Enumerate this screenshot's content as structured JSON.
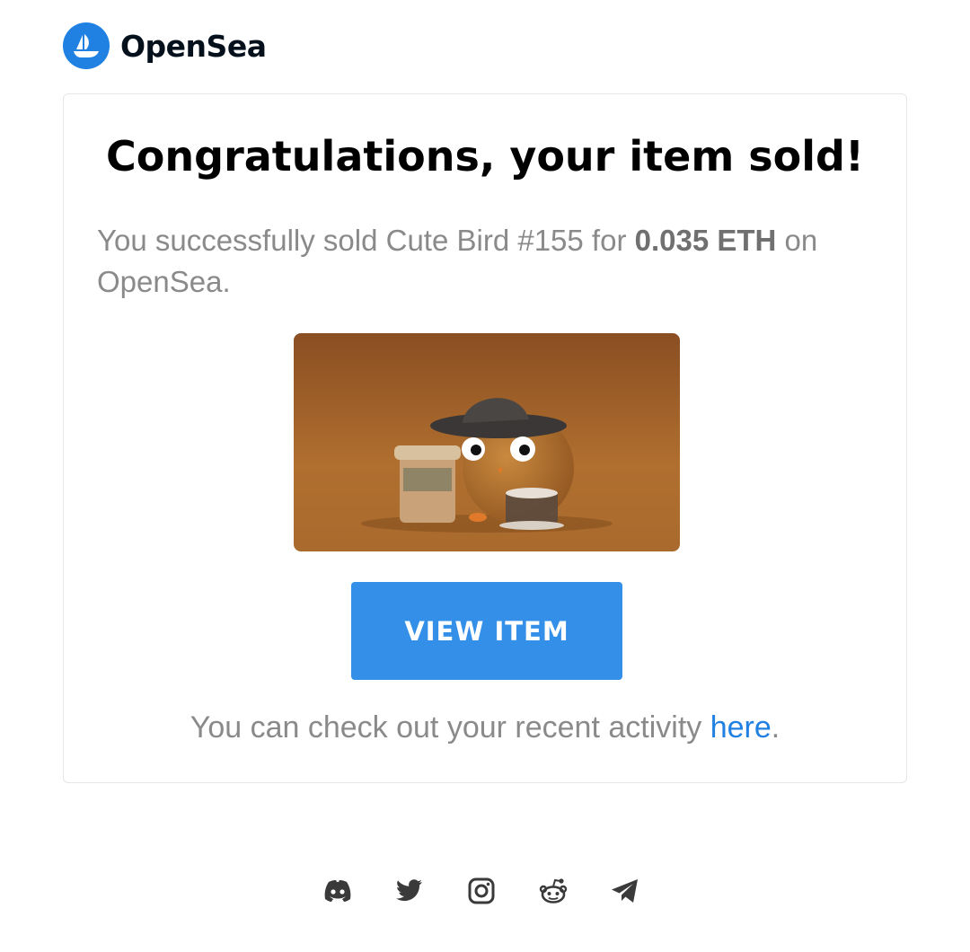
{
  "header": {
    "brand": "OpenSea",
    "logo_icon": "opensea-boat-icon",
    "brand_color": "#2081e2"
  },
  "card": {
    "title": "Congratulations, your item sold!",
    "description_prefix": "You successfully sold Cute Bird #155 for ",
    "amount": "0.035 ETH",
    "description_suffix": " on OpenSea.",
    "image_alt": "Cute Bird #155",
    "button_label": "VIEW ITEM",
    "button_color": "#338fe8",
    "activity_prefix": "You can check out your recent activity ",
    "activity_link": "here",
    "activity_suffix": "."
  },
  "footer": {
    "social_icons": [
      "discord-icon",
      "twitter-icon",
      "instagram-icon",
      "reddit-icon",
      "telegram-icon"
    ]
  }
}
